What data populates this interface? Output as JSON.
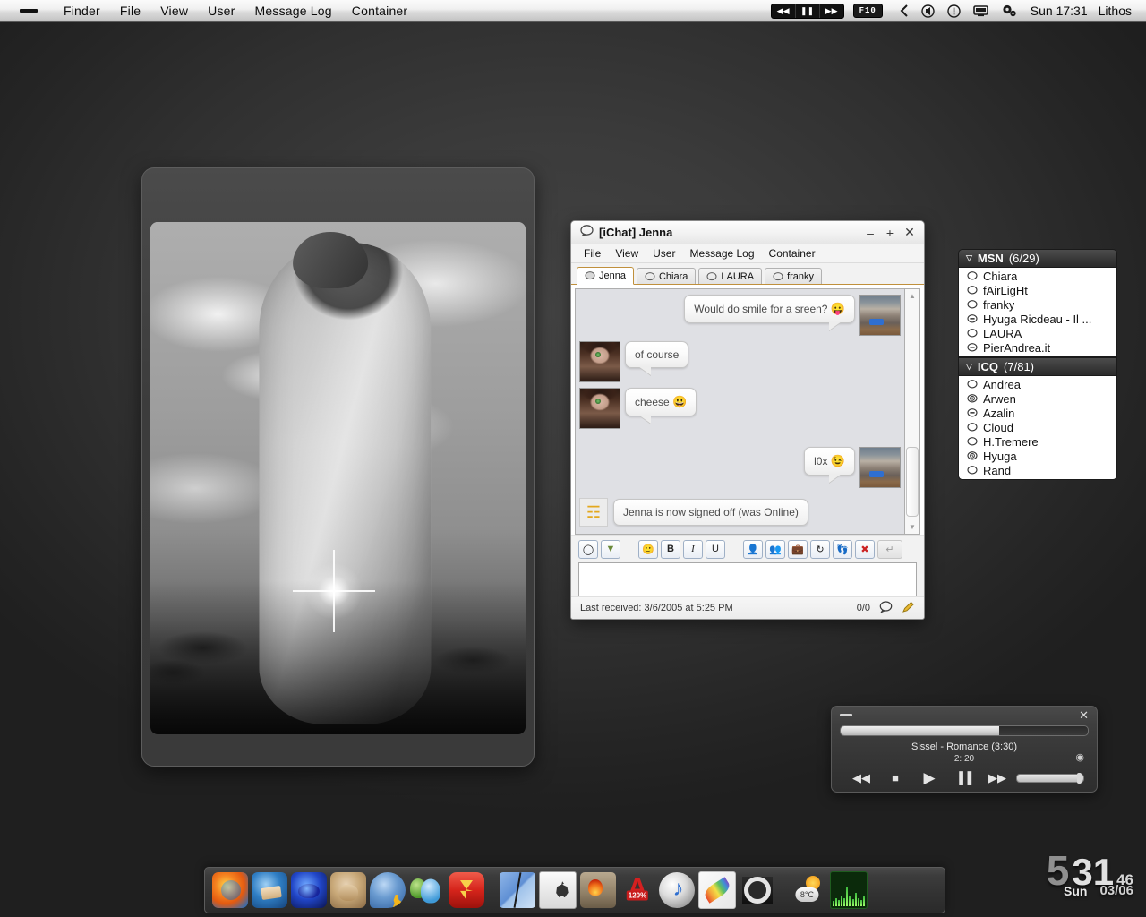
{
  "menubar": {
    "apple_icon": "dash-icon",
    "items": [
      "Finder",
      "File",
      "View",
      "User",
      "Message Log",
      "Container"
    ],
    "transport": [
      "rewind-icon",
      "pause-icon",
      "fast-forward-icon"
    ],
    "fkey": "F10",
    "tray_icons": [
      "back-chevron-icon",
      "volume-icon",
      "info-circle-icon",
      "display-icon",
      "gears-icon"
    ],
    "clock": "Sun 17:31",
    "user": "Lithos"
  },
  "chat_window": {
    "title": "[iChat] Jenna",
    "title_icon": "chat-bubble-icon",
    "window_buttons": [
      "minimize",
      "maximize",
      "close"
    ],
    "menu": [
      "File",
      "View",
      "User",
      "Message Log",
      "Container"
    ],
    "tabs": [
      {
        "label": "Jenna",
        "active": true
      },
      {
        "label": "Chiara",
        "active": false
      },
      {
        "label": "LAURA",
        "active": false
      },
      {
        "label": "franky",
        "active": false
      }
    ],
    "messages": [
      {
        "side": "right",
        "text": "Would do smile for a sreen?",
        "emoji": "😛",
        "avatar": "cat"
      },
      {
        "side": "left",
        "text": "of course",
        "emoji": "",
        "avatar": "jenna"
      },
      {
        "side": "left",
        "text": "cheese",
        "emoji": "😃",
        "avatar": "jenna"
      },
      {
        "side": "right",
        "text": "l0x",
        "emoji": "😉",
        "avatar": "cat"
      }
    ],
    "system_message": {
      "icon": "running-man-icon",
      "text": "Jenna is now signed off (was Online)"
    },
    "toolbar": [
      {
        "name": "chat-bubble-icon",
        "glyph": "◯"
      },
      {
        "name": "dropdown-arrow-icon",
        "glyph": "▼"
      },
      {
        "name": "smiley-icon",
        "glyph": "🙂"
      },
      {
        "name": "bold-button",
        "glyph": "B"
      },
      {
        "name": "italic-button",
        "glyph": "I"
      },
      {
        "name": "underline-button",
        "glyph": "U"
      },
      {
        "name": "contact-info-icon",
        "glyph": "👤"
      },
      {
        "name": "group-chat-icon",
        "glyph": "👥"
      },
      {
        "name": "file-transfer-icon",
        "glyph": "💼"
      },
      {
        "name": "history-icon",
        "glyph": "↻"
      },
      {
        "name": "nudge-icon",
        "glyph": "👣"
      },
      {
        "name": "close-red-icon",
        "glyph": "✖"
      },
      {
        "name": "send-button",
        "glyph": "↵"
      }
    ],
    "input_value": "",
    "input_placeholder": "",
    "status": {
      "last_received": "Last received: 3/6/2005 at 5:25 PM",
      "counter": "0/0",
      "icons": [
        "chat-bubble-icon",
        "pencil-icon"
      ]
    },
    "scrollbar": {
      "up": "▲",
      "down": "▼"
    }
  },
  "contacts": {
    "groups": [
      {
        "name": "MSN",
        "count": "(6/29)",
        "collapse_icon": "▽",
        "items": [
          {
            "name": "Chiara",
            "status": "online"
          },
          {
            "name": "fAirLigHt",
            "status": "online"
          },
          {
            "name": "franky",
            "status": "online"
          },
          {
            "name": "Hyuga Ricdeau - Il ...",
            "status": "busy"
          },
          {
            "name": "LAURA",
            "status": "online"
          },
          {
            "name": "PierAndrea.it",
            "status": "busy"
          }
        ]
      },
      {
        "name": "ICQ",
        "count": "(7/81)",
        "collapse_icon": "▽",
        "items": [
          {
            "name": "Andrea",
            "status": "online"
          },
          {
            "name": "Arwen",
            "status": "away"
          },
          {
            "name": "Azalin",
            "status": "busy"
          },
          {
            "name": "Cloud",
            "status": "online"
          },
          {
            "name": "H.Tremere",
            "status": "online"
          },
          {
            "name": "Hyuga",
            "status": "away"
          },
          {
            "name": "Rand",
            "status": "online"
          }
        ]
      }
    ]
  },
  "player": {
    "collapse_icon": "dash-icon",
    "minimize_label": "–",
    "close_label": "✕",
    "track": "Sissel - Romance (3:30)",
    "elapsed": "2: 20",
    "progress_percent": 64,
    "record_icon": "◉",
    "controls": [
      {
        "name": "previous-button",
        "glyph": "◀◀"
      },
      {
        "name": "stop-button",
        "glyph": "■"
      },
      {
        "name": "play-button",
        "glyph": "▶"
      },
      {
        "name": "pause-button",
        "glyph": "▐▐"
      },
      {
        "name": "next-button",
        "glyph": "▶▶"
      }
    ]
  },
  "dock": {
    "group1": [
      {
        "name": "firefox",
        "class": "d-firefox"
      },
      {
        "name": "thunderbird",
        "class": "d-thunderbird"
      },
      {
        "name": "azureus",
        "class": "d-azureus"
      },
      {
        "name": "emule",
        "class": "d-emule"
      },
      {
        "name": "ichat",
        "class": "d-ichat"
      },
      {
        "name": "msn-messenger",
        "class": "d-msn"
      },
      {
        "name": "download-manager",
        "class": "d-getright"
      }
    ],
    "group2": [
      {
        "name": "finder",
        "class": "d-finder"
      },
      {
        "name": "disk-utility",
        "class": "d-drive"
      },
      {
        "name": "nero-burning-rom",
        "class": "d-nero"
      },
      {
        "name": "acrobat",
        "class": "d-acrobat"
      },
      {
        "name": "itunes",
        "class": "d-itunes"
      },
      {
        "name": "image-editor",
        "class": "d-feather"
      },
      {
        "name": "video-converter",
        "class": "d-filmgear"
      }
    ],
    "group3": [
      {
        "name": "weather-widget",
        "class": "d-weather"
      },
      {
        "name": "audio-visualizer",
        "class": "d-visualizer"
      }
    ]
  },
  "clock_widget": {
    "hour": "5",
    "minute": "31",
    "second": "46",
    "day": "Sun",
    "date": "03/06"
  },
  "colors": {
    "desktop": "#3c3c3c",
    "tab_accent": "#c0903c",
    "bubble": "#ffffff",
    "msgpane": "#dfe0e4"
  }
}
